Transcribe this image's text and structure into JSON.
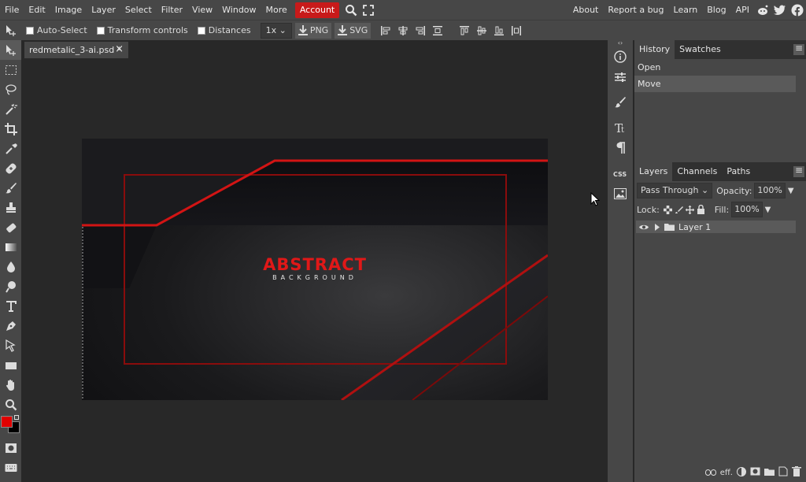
{
  "menu": {
    "items": [
      "File",
      "Edit",
      "Image",
      "Layer",
      "Select",
      "Filter",
      "View",
      "Window",
      "More"
    ],
    "account": "Account",
    "right": [
      "About",
      "Report a bug",
      "Learn",
      "Blog",
      "API"
    ]
  },
  "options": {
    "auto_select": "Auto-Select",
    "transform_controls": "Transform controls",
    "distances": "Distances",
    "zoom": "1x",
    "png": "PNG",
    "svg": "SVG"
  },
  "document": {
    "tab_title": "redmetalic_3-ai.psd *",
    "close": "×"
  },
  "artwork": {
    "title": "ABSTRACT",
    "subtitle": "BACKGROUND"
  },
  "history_panel": {
    "tabs": [
      "History",
      "Swatches"
    ],
    "rows": [
      "Open",
      "Move"
    ]
  },
  "layers_panel": {
    "tabs": [
      "Layers",
      "Channels",
      "Paths"
    ],
    "blend_mode": "Pass Through",
    "opacity_label": "Opacity:",
    "opacity_value": "100%",
    "lock_label": "Lock:",
    "fill_label": "Fill:",
    "fill_value": "100%",
    "layers": [
      {
        "name": "Layer 1"
      }
    ],
    "footer_eff": "eff."
  },
  "colors": {
    "foreground": "#e00000",
    "background": "#000000",
    "accent": "#c81a1a"
  }
}
